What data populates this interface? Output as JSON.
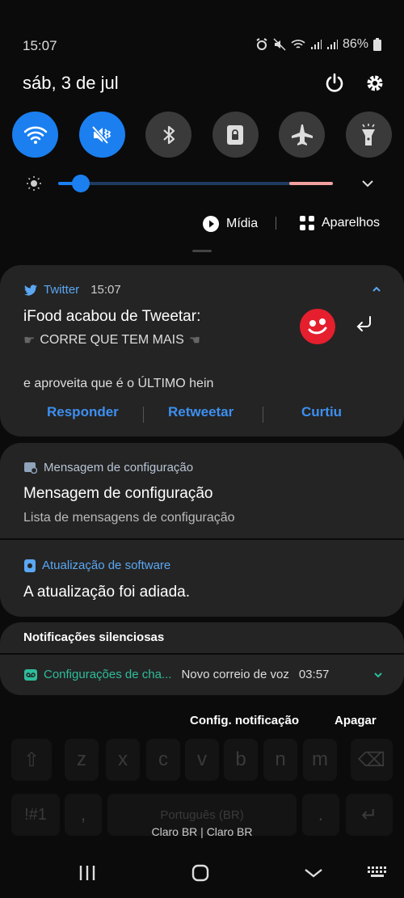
{
  "status": {
    "time": "15:07",
    "battery": "86%"
  },
  "header": {
    "date": "sáb, 3 de jul"
  },
  "media": {
    "media_label": "Mídia",
    "devices_label": "Aparelhos"
  },
  "twitter": {
    "app": "Twitter",
    "time": "15:07",
    "title": "iFood acabou de Tweetar:",
    "line1": "CORRE QUE TEM MAIS",
    "line2": "e aproveita que é o ÚLTIMO hein",
    "actions": [
      "Responder",
      "Retweetar",
      "Curtiu"
    ]
  },
  "config_msg": {
    "app": "Mensagem de configuração",
    "title": "Mensagem de configuração",
    "subtitle": "Lista de mensagens de configuração"
  },
  "software": {
    "app": "Atualização de software",
    "title": "A atualização foi adiada."
  },
  "silent": {
    "title": "Notificações silenciosas",
    "app": "Configurações de cha...",
    "text": "Novo correio de voz",
    "time": "03:57"
  },
  "footer": {
    "settings": "Config. notificação",
    "clear": "Apagar"
  },
  "keyboard": {
    "row1": [
      "z",
      "x",
      "c",
      "v",
      "b",
      "n",
      "m"
    ],
    "sym": "!#1",
    "comma": ",",
    "space": "Português (BR)",
    "period": "."
  },
  "carrier": "Claro BR | Claro BR",
  "colors": {
    "accent": "#1b7ff0",
    "twitter": "#5aa7f2",
    "ifood": "#e51f2d",
    "voicemail": "#2ebd9b"
  }
}
